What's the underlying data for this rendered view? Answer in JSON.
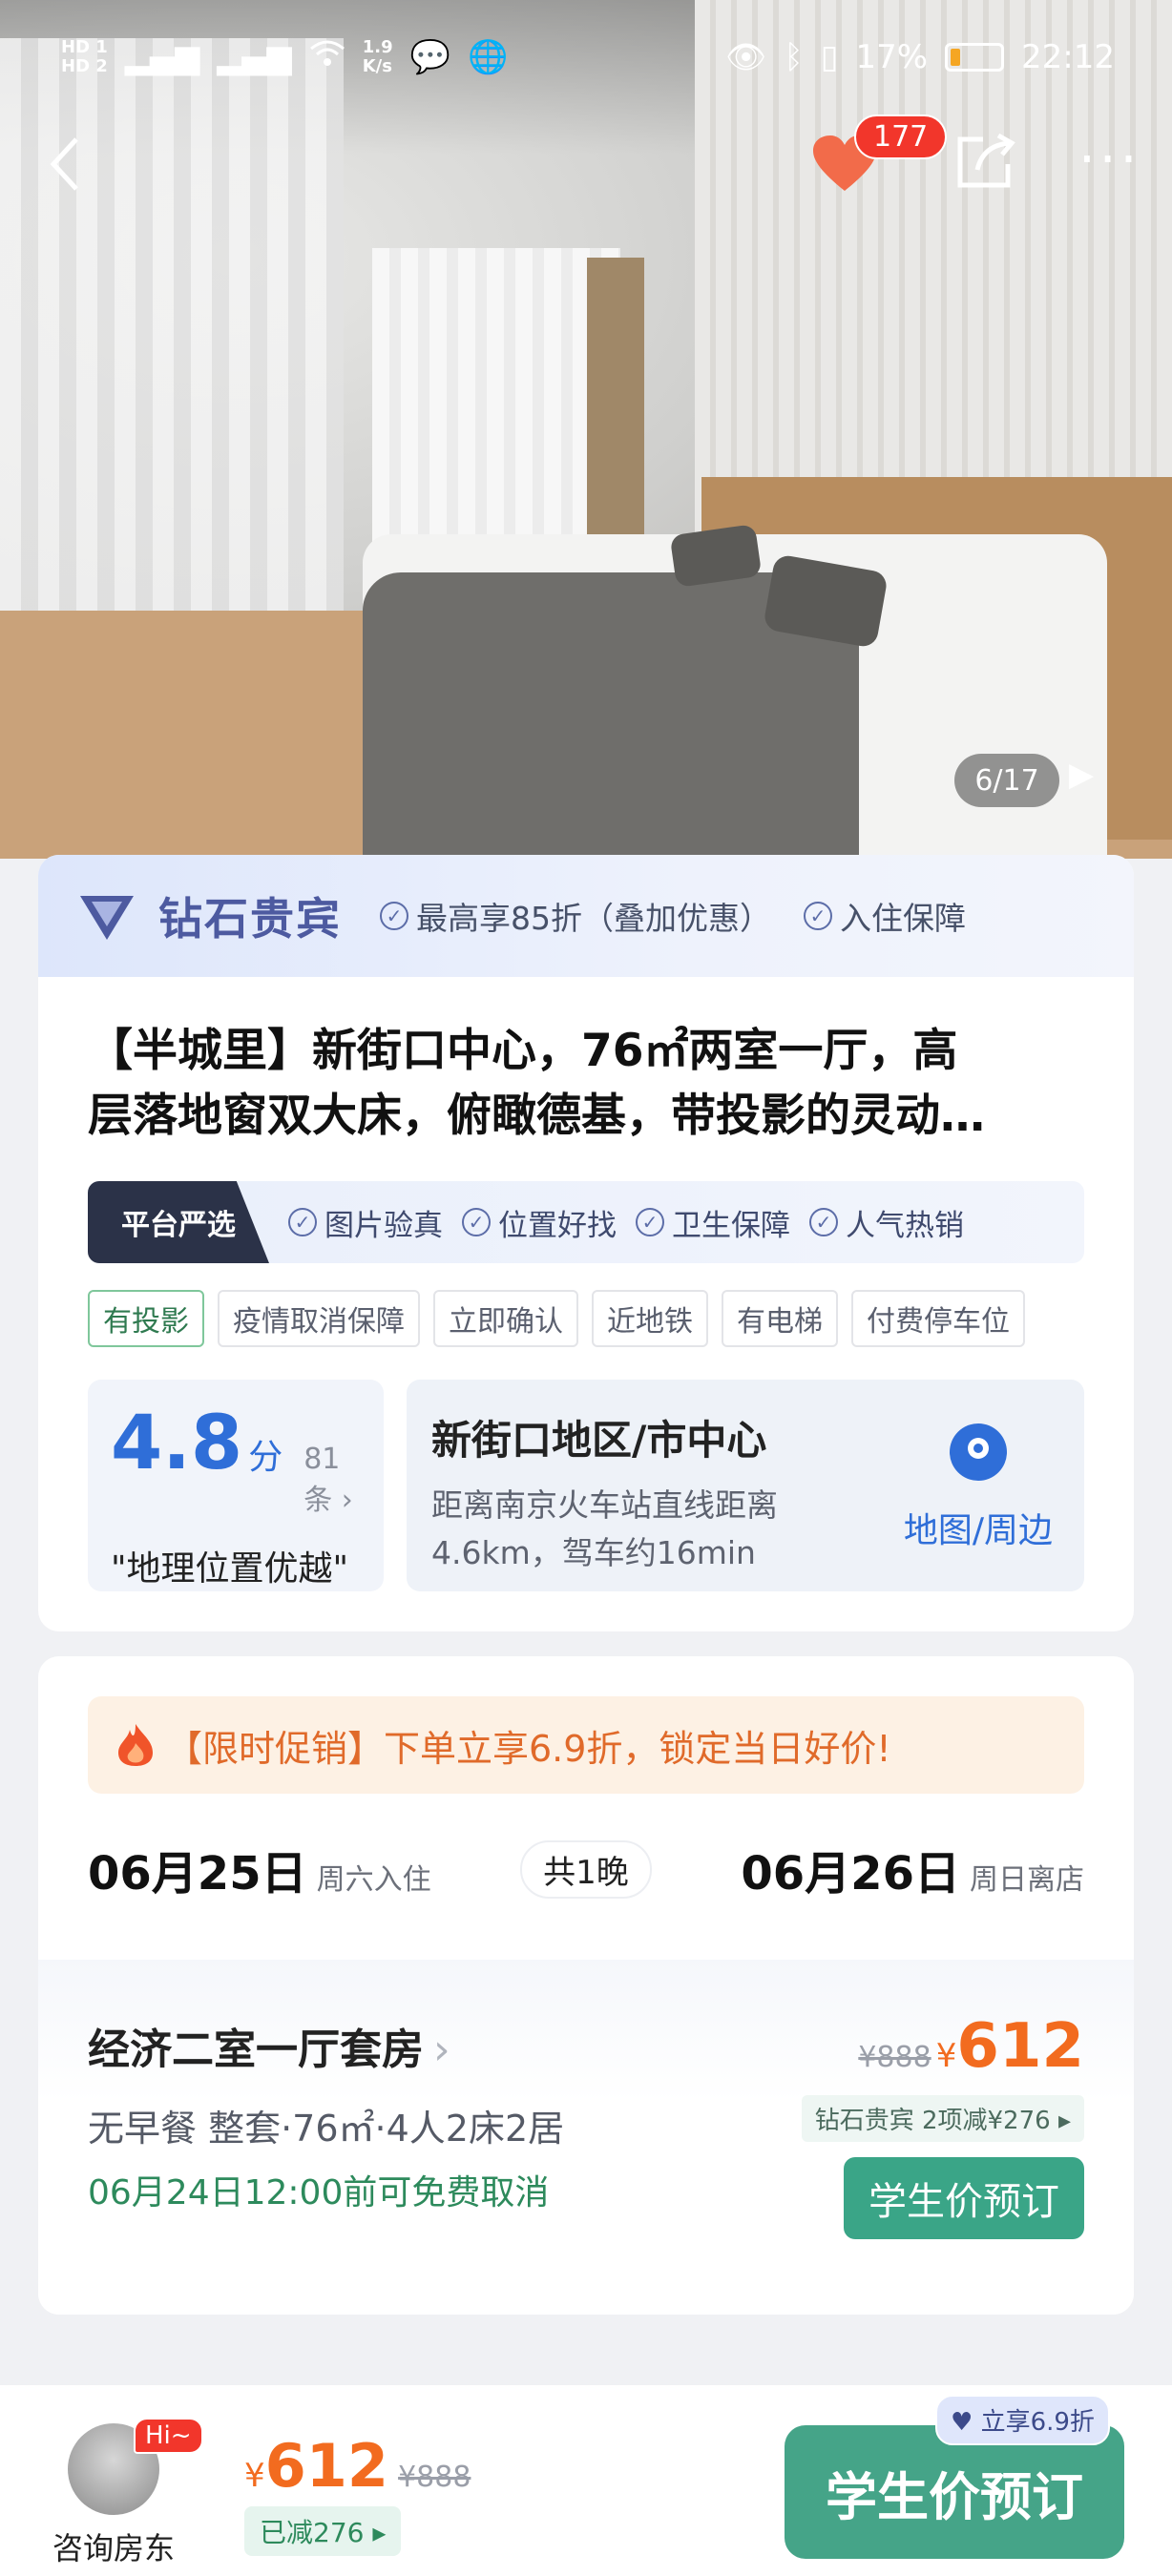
{
  "status_bar": {
    "left_sim1": "HD 1",
    "left_sim2": "HD 2",
    "signal1": "46",
    "signal2": "46",
    "wifi": "6",
    "speed": "1.9\nK/s",
    "battery": "17%",
    "time": "22:12"
  },
  "gallery": {
    "favorites_count": "177",
    "counter": "6/17"
  },
  "vip": {
    "title": "钻石贵宾",
    "perks": [
      "最高享85折（叠加优惠）",
      "入住保障"
    ]
  },
  "listing": {
    "title_line1": "【半城里】新街口中心，76㎡两室一厅，高",
    "title_line2": "层落地窗双大床，俯瞰德基，带投影的灵动…",
    "platform_pick": "平台严选",
    "pick_items": [
      "图片验真",
      "位置好找",
      "卫生保障",
      "人气热销"
    ],
    "tags": [
      "有投影",
      "疫情取消保障",
      "立即确认",
      "近地铁",
      "有电梯",
      "付费停车位"
    ]
  },
  "rating": {
    "score": "4.8",
    "unit": "分",
    "count": "81条",
    "desc": "\"地理位置优越\""
  },
  "location": {
    "title": "新街口地区/市中心",
    "desc": "距离南京火车站直线距离4.6km，驾车约16min",
    "map_label": "地图/周边"
  },
  "promo": {
    "text": "【限时促销】下单立享6.9折，锁定当日好价!"
  },
  "dates": {
    "checkin": "06月25日",
    "checkin_sub": "周六入住",
    "nights": "共1晚",
    "checkout": "06月26日",
    "checkout_sub": "周日离店"
  },
  "room": {
    "name": "经济二室一厅套房",
    "info": "无早餐  整套·76㎡·4人2床2居",
    "cancel": "06月24日12:00前可免费取消",
    "old_price": "¥888",
    "yen": "¥",
    "price": "612",
    "discount_tag": "钻石贵宾  2项减¥276 ▸",
    "book_label": "学生价预订"
  },
  "bottom": {
    "hi": "Hi~",
    "host_label": "咨询房东",
    "yen": "¥",
    "price": "612",
    "old_price": "¥888",
    "reduced": "已减276 ▸",
    "instant": "立享6.9折",
    "book_label": "学生价预订"
  },
  "colors": {
    "accent_orange": "#f26b1f",
    "accent_green": "#45a488",
    "accent_blue": "#2f6ed8",
    "badge_red": "#f2362b"
  }
}
